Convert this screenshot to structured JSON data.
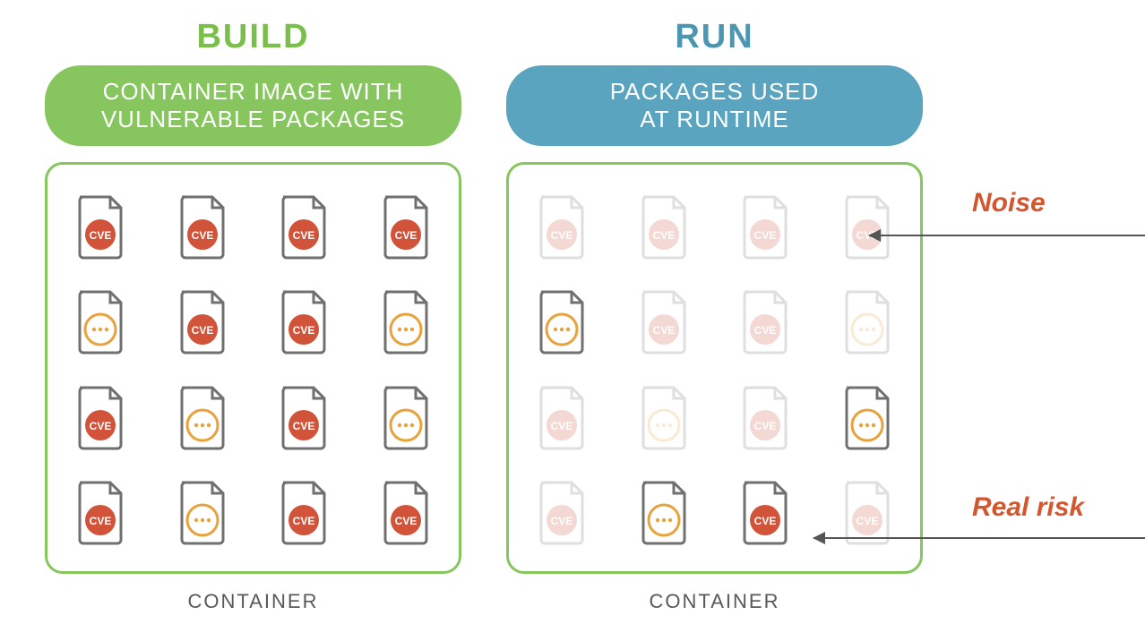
{
  "colors": {
    "green": "#87c55f",
    "blue": "#5aa4bf",
    "cve": "#d0533a",
    "other": "#e8a23c",
    "fileStroke": "#707070"
  },
  "annotations": {
    "noise": "Noise",
    "realRisk": "Real risk"
  },
  "build": {
    "stage": "BUILD",
    "pillLine1": "CONTAINER IMAGE WITH",
    "pillLine2": "VULNERABLE PACKAGES",
    "boxLabel": "CONTAINER",
    "grid": [
      [
        "cve",
        "cve",
        "cve",
        "cve"
      ],
      [
        "other",
        "cve",
        "cve",
        "other"
      ],
      [
        "cve",
        "other",
        "cve",
        "other"
      ],
      [
        "cve",
        "other",
        "cve",
        "cve"
      ]
    ]
  },
  "run": {
    "stage": "RUN",
    "pillLine1": "PACKAGES USED",
    "pillLine2": "AT RUNTIME",
    "boxLabel": "CONTAINER",
    "grid": [
      [
        "cve-f",
        "cve-f",
        "cve-f",
        "cve-f"
      ],
      [
        "other",
        "cve-f",
        "cve-f",
        "other-f"
      ],
      [
        "cve-f",
        "other-f",
        "cve-f",
        "other"
      ],
      [
        "cve-f",
        "other",
        "cve",
        "cve-f"
      ]
    ]
  }
}
